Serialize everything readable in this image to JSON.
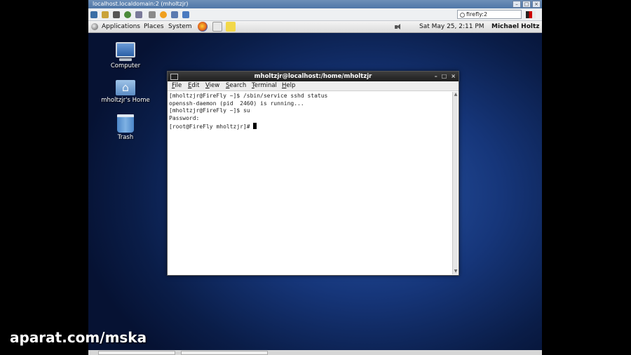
{
  "vnc": {
    "title": "localhost.localdomain:2 (mholtzjr)",
    "host_field": "firefly:2",
    "toolbar_icons": [
      "screen-icon",
      "lock-icon",
      "tools-icon",
      "refresh-icon",
      "keys-icon",
      "clipboard-icon",
      "info-icon",
      "transfer-icon",
      "fullscreen-icon"
    ]
  },
  "panel": {
    "applications": "Applications",
    "places": "Places",
    "system": "System",
    "datetime": "Sat May 25,  2:11 PM",
    "user": "Michael Holtz"
  },
  "desktop": {
    "icons": [
      {
        "label": "Computer"
      },
      {
        "label": "mholtzjr's Home"
      },
      {
        "label": "Trash"
      }
    ]
  },
  "terminal": {
    "title": "mholtzjr@localhost:/home/mholtzjr",
    "menu": [
      "File",
      "Edit",
      "View",
      "Search",
      "Terminal",
      "Help"
    ],
    "lines": [
      "[mholtzjr@FireFly ~]$ /sbin/service sshd status",
      "openssh-daemon (pid  2460) is running...",
      "[mholtzjr@FireFly ~]$ su",
      "Password:",
      "[root@FireFly mholtzjr]# "
    ]
  },
  "watermark": "aparat.com/mska",
  "colors": {
    "desktop_center": "#2a56a8",
    "desktop_edge": "#061233",
    "terminal_titlebar": "#2b2b2b"
  }
}
